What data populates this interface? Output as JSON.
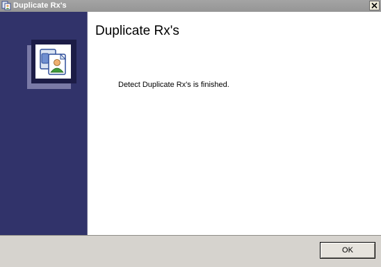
{
  "window": {
    "title": "Duplicate Rx's",
    "close_icon": "close-icon",
    "app_icon": "app-icon"
  },
  "banner": {
    "icon": "duplicate-person-icon",
    "colors": {
      "panel": "#31336a",
      "frame": "#1c1c46",
      "shadow": "#7a7aa6"
    }
  },
  "content": {
    "heading": "Duplicate Rx's",
    "message": "Detect Duplicate Rx's is finished."
  },
  "footer": {
    "ok_label": "OK"
  }
}
